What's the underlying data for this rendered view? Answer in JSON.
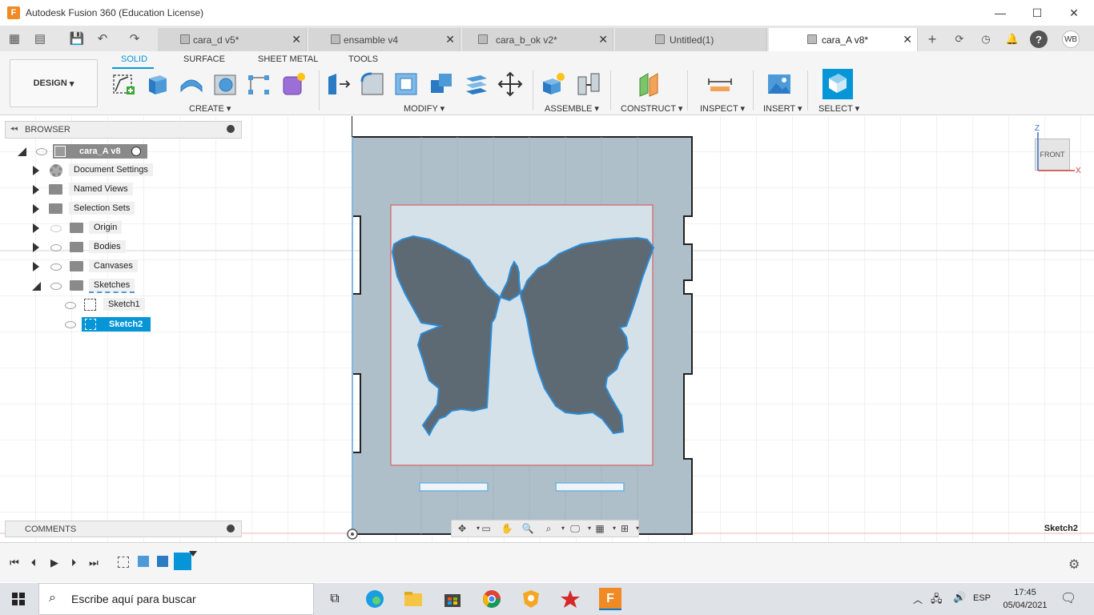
{
  "window": {
    "title": "Autodesk Fusion 360 (Education License)",
    "minimize": "—",
    "maximize": "☐",
    "close": "✕"
  },
  "tabs": [
    {
      "label": "cara_d v5*"
    },
    {
      "label": "ensamble v4"
    },
    {
      "label": "cara_b_ok v2*"
    },
    {
      "label": "Untitled(1)"
    },
    {
      "label": "cara_A v8*",
      "active": true
    }
  ],
  "user_initials": "WB",
  "toolbar": {
    "workspace": "DESIGN",
    "tabs": [
      "SOLID",
      "SURFACE",
      "SHEET METAL",
      "TOOLS"
    ],
    "groups": [
      "CREATE",
      "MODIFY",
      "ASSEMBLE",
      "CONSTRUCT",
      "INSPECT",
      "INSERT",
      "SELECT"
    ]
  },
  "browser": {
    "title": "BROWSER",
    "root": "cara_A v8",
    "items": [
      "Document Settings",
      "Named Views",
      "Selection Sets",
      "Origin",
      "Bodies",
      "Canvases",
      "Sketches"
    ],
    "sketches": [
      "Sketch1",
      "Sketch2"
    ]
  },
  "comments": {
    "title": "COMMENTS"
  },
  "viewcube": {
    "face": "FRONT",
    "axis_z": "Z",
    "axis_x": "X"
  },
  "status": {
    "active_sketch": "Sketch2"
  },
  "taskbar": {
    "search_placeholder": "Escribe aquí para buscar",
    "language": "ESP",
    "time": "17:45",
    "date": "05/04/2021"
  },
  "colors": {
    "accent": "#0696d7",
    "panel_fill": "#aebfca",
    "sketch_area": "#d4e1e8",
    "butterfly": "#5e6a73",
    "constraint_red": "#e04a4a"
  }
}
